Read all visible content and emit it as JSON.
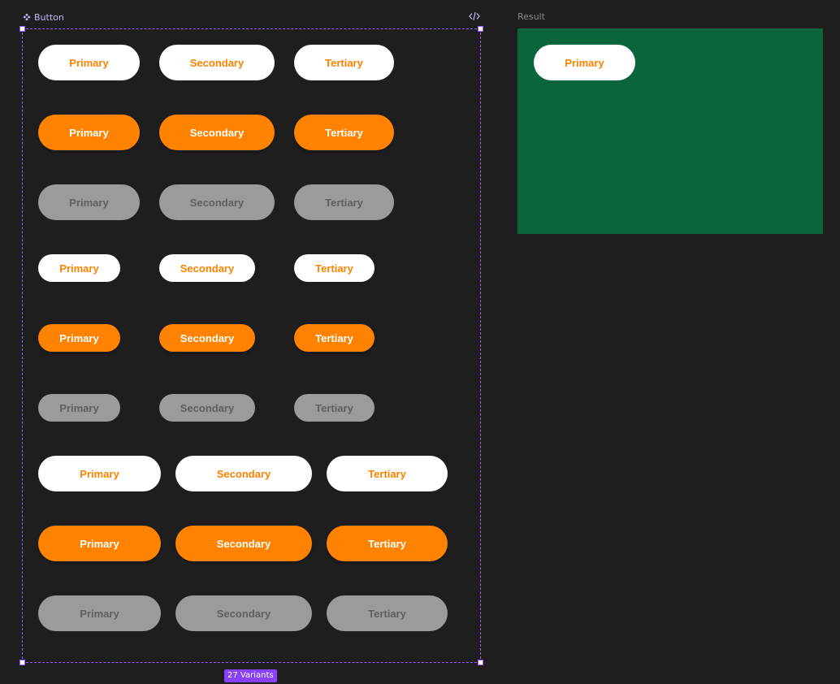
{
  "component": {
    "title": "Button",
    "icon": "component-diamond-icon",
    "code_icon": "code-icon",
    "variant_count": "27 Variants"
  },
  "rows": [
    {
      "size": "md",
      "state": "default",
      "labels": [
        "Primary",
        "Secondary",
        "Tertiary"
      ]
    },
    {
      "size": "md",
      "state": "active",
      "labels": [
        "Primary",
        "Secondary",
        "Tertiary"
      ]
    },
    {
      "size": "md",
      "state": "disabled",
      "labels": [
        "Primary",
        "Secondary",
        "Tertiary"
      ]
    },
    {
      "size": "sm",
      "state": "default",
      "labels": [
        "Primary",
        "Secondary",
        "Tertiary"
      ]
    },
    {
      "size": "sm",
      "state": "active",
      "labels": [
        "Primary",
        "Secondary",
        "Tertiary"
      ]
    },
    {
      "size": "sm",
      "state": "disabled",
      "labels": [
        "Primary",
        "Secondary",
        "Tertiary"
      ]
    },
    {
      "size": "lg",
      "state": "default",
      "labels": [
        "Primary",
        "Secondary",
        "Tertiary"
      ]
    },
    {
      "size": "lg",
      "state": "active",
      "labels": [
        "Primary",
        "Secondary",
        "Tertiary"
      ]
    },
    {
      "size": "lg",
      "state": "disabled",
      "labels": [
        "Primary",
        "Secondary",
        "Tertiary"
      ]
    }
  ],
  "result": {
    "label": "Result",
    "button_label": "Primary",
    "background": "#0b653c"
  },
  "colors": {
    "canvas": "#1e1e1e",
    "accent_orange": "#ff8200",
    "button_white": "#ffffff",
    "disabled_gray": "#9b9b9b",
    "disabled_text": "#5f5f5f",
    "selection_purple": "#9b5cff",
    "badge_purple": "#8a3ffc"
  }
}
